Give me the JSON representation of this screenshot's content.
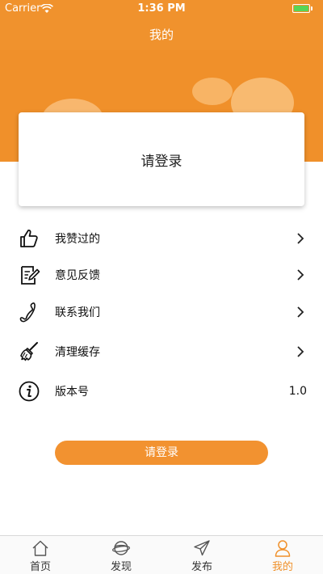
{
  "status_bar": {
    "carrier": "Carrier",
    "time": "1:36 PM",
    "battery_level": 1.0
  },
  "nav": {
    "title": "我的"
  },
  "login_card": {
    "label": "请登录"
  },
  "menu": [
    {
      "label": "我赞过的",
      "icon": "thumbs-up-icon"
    },
    {
      "label": "意见反馈",
      "icon": "feedback-edit-icon"
    },
    {
      "label": "联系我们",
      "icon": "phone-icon"
    },
    {
      "label": "清理缓存",
      "icon": "broom-icon"
    },
    {
      "label": "版本号",
      "icon": "info-icon",
      "value": "1.0"
    }
  ],
  "login_button": {
    "label": "请登录"
  },
  "tabs": [
    {
      "label": "首页",
      "icon": "home-icon",
      "active": false
    },
    {
      "label": "发现",
      "icon": "planet-icon",
      "active": false
    },
    {
      "label": "发布",
      "icon": "paper-plane-icon",
      "active": false
    },
    {
      "label": "我的",
      "icon": "user-icon",
      "active": true
    }
  ],
  "colors": {
    "accent": "#f0902a",
    "tab_active": "#f0902a",
    "battery": "#59d456"
  }
}
